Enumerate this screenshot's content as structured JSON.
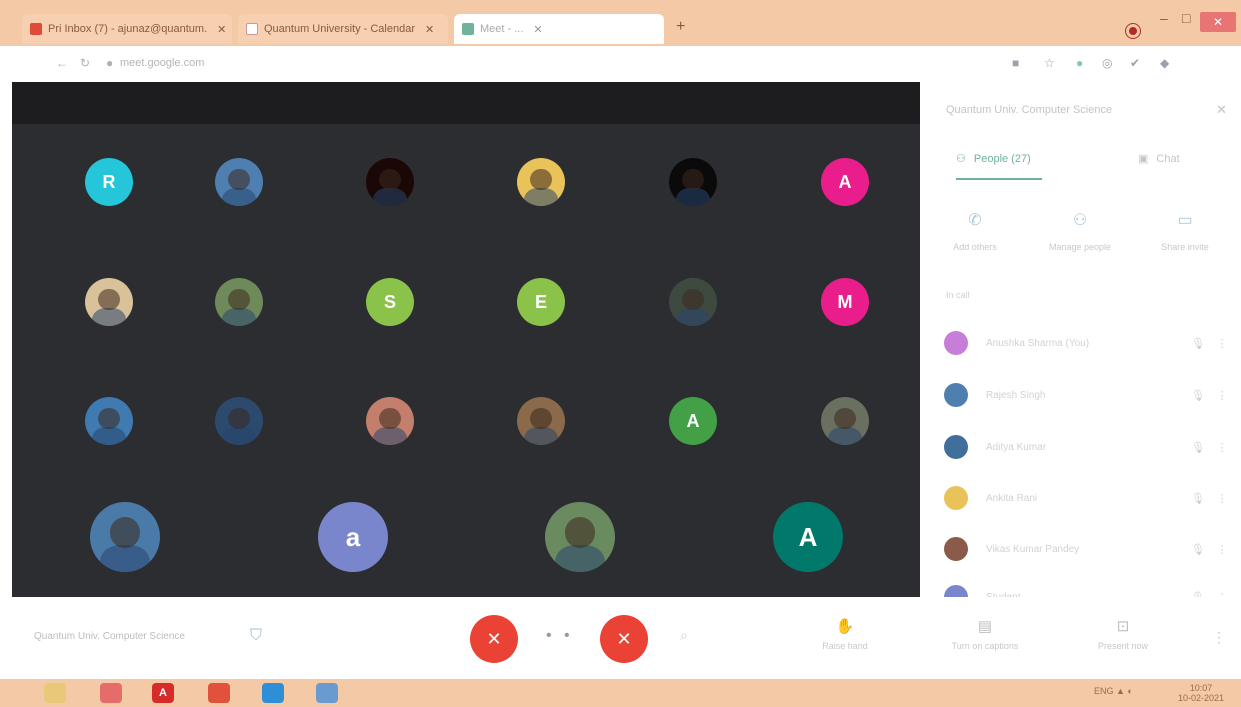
{
  "browser": {
    "tabs": [
      {
        "label": "Pri  Inbox (7) - ajunaz@quantum.",
        "fav_color": "#e04a3a"
      },
      {
        "label": "Quantum University - Calendar",
        "fav_color": "#ffffff"
      },
      {
        "label": "Meet - ...",
        "fav_color": "#6fb39a"
      }
    ],
    "tab_close": "✕",
    "new_tab": "+",
    "window": {
      "minimize": "–",
      "maximize": "□",
      "close": "✕"
    },
    "url": "meet.google.com"
  },
  "participants_grid": [
    {
      "kind": "initial",
      "text": "R",
      "color": "#26c6da"
    },
    {
      "kind": "photo",
      "text": "",
      "color": "#4f7fb0"
    },
    {
      "kind": "photo",
      "text": "",
      "color": "#1a0706"
    },
    {
      "kind": "photo",
      "text": "",
      "color": "#e9c25a"
    },
    {
      "kind": "photo",
      "text": "",
      "color": "#0a0a0a"
    },
    {
      "kind": "initial",
      "text": "A",
      "color": "#e91e8c"
    },
    {
      "kind": "photo",
      "text": "",
      "color": "#d9c29a"
    },
    {
      "kind": "photo",
      "text": "",
      "color": "#6f8a5a"
    },
    {
      "kind": "initial",
      "text": "S",
      "color": "#8bc34a"
    },
    {
      "kind": "initial",
      "text": "E",
      "color": "#8bc34a"
    },
    {
      "kind": "photo",
      "text": "",
      "color": "#3e4a40"
    },
    {
      "kind": "initial",
      "text": "M",
      "color": "#e91e8c"
    },
    {
      "kind": "photo",
      "text": "",
      "color": "#3f7bb0"
    },
    {
      "kind": "photo",
      "text": "",
      "color": "#2c4a6e"
    },
    {
      "kind": "photo",
      "text": "",
      "color": "#c47f6c"
    },
    {
      "kind": "photo",
      "text": "",
      "color": "#8a6a4a"
    },
    {
      "kind": "initial",
      "text": "A",
      "color": "#43a047"
    },
    {
      "kind": "photo",
      "text": "",
      "color": "#6a7060"
    },
    {
      "kind": "photo",
      "text": "",
      "color": "#4a7aa8"
    },
    {
      "kind": "initial",
      "text": "a",
      "color": "#7986cb"
    },
    {
      "kind": "photo",
      "text": "",
      "color": "#6a8a60"
    },
    {
      "kind": "initial",
      "text": "A",
      "color": "#00796b"
    }
  ],
  "panel": {
    "title": "Quantum Univ. Computer Science",
    "close": "✕",
    "tab_people": "People (27)",
    "tab_chat": "Chat",
    "actions": [
      {
        "icon": "✆",
        "label": "Add others"
      },
      {
        "icon": "⚇",
        "label": "Manage people"
      },
      {
        "icon": "▭",
        "label": "Share invite"
      }
    ],
    "section": "In call",
    "people": [
      {
        "name": "Anushka Sharma (You)",
        "color": "#c77ed8"
      },
      {
        "name": "Rajesh Singh",
        "color": "#4f7fb0"
      },
      {
        "name": "Aditya Kumar",
        "color": "#3f6f9a"
      },
      {
        "name": "Ankita Rani",
        "color": "#e9c25a"
      },
      {
        "name": "Vikas Kumar Pandey",
        "color": "#8a5a4a"
      },
      {
        "name": "Student",
        "color": "#7986cb"
      }
    ],
    "mic_icon": "🎙",
    "more_icon": "⋮"
  },
  "controls": {
    "meeting_name": "Quantum Univ. Computer Science",
    "mic": "✕",
    "dots": "• •",
    "cam": "✕",
    "cc": "⌕",
    "raise_hand": {
      "icon": "✋",
      "label": "Raise hand"
    },
    "captions": {
      "icon": "▤",
      "label": "Turn on captions"
    },
    "present": {
      "icon": "⊡",
      "label": "Present now"
    },
    "more": "⋮"
  },
  "taskbar": {
    "apps": [
      {
        "name": "file-explorer",
        "glyph": "",
        "color": "#e8c97a"
      },
      {
        "name": "firefox",
        "glyph": "",
        "color": "#e66b6b"
      },
      {
        "name": "acrobat",
        "glyph": "A",
        "color": "#d62b2b"
      },
      {
        "name": "chrome",
        "glyph": "",
        "color": "#e0523c"
      },
      {
        "name": "edge",
        "glyph": "",
        "color": "#2f8fd6"
      },
      {
        "name": "photos",
        "glyph": "",
        "color": "#6a9bd0"
      }
    ],
    "tray": "ENG  ▲  ◐",
    "time": "10:07",
    "date": "10-02-2021"
  }
}
